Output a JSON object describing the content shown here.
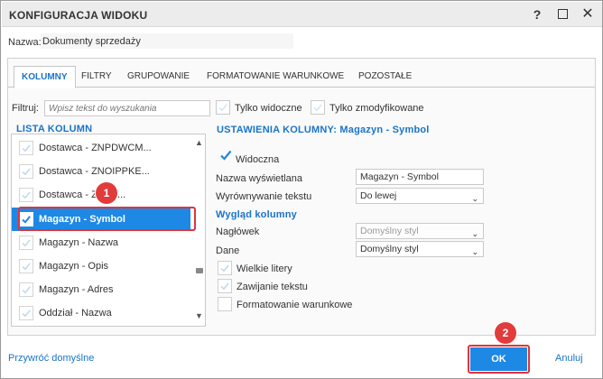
{
  "window": {
    "title": "KONFIGURACJA WIDOKU",
    "help_glyph": "?",
    "close_glyph": "✕"
  },
  "name": {
    "label": "Nazwa:",
    "value": "Dokumenty sprzedaży"
  },
  "tabs": [
    {
      "label": "KOLUMNY",
      "active": true
    },
    {
      "label": "FILTRY",
      "active": false
    },
    {
      "label": "GRUPOWANIE",
      "active": false
    },
    {
      "label": "FORMATOWANIE WARUNKOWE",
      "active": false
    },
    {
      "label": "POZOSTAŁE",
      "active": false
    }
  ],
  "filter": {
    "label": "Filtruj:",
    "placeholder": "Wpisz tekst do wyszukania",
    "only_visible": "Tylko widoczne",
    "only_modified": "Tylko zmodyfikowane"
  },
  "column_list": {
    "title": "LISTA KOLUMN",
    "items": [
      {
        "label": "Dostawca - ZNPDWCM...",
        "checked": true,
        "selected": false
      },
      {
        "label": "Dostawca - ZNOIPPKE...",
        "checked": true,
        "selected": false
      },
      {
        "label": "Dostawca - ZNNV...",
        "checked": true,
        "selected": false
      },
      {
        "label": "Magazyn - Symbol",
        "checked": true,
        "selected": true
      },
      {
        "label": "Magazyn - Nazwa",
        "checked": true,
        "selected": false
      },
      {
        "label": "Magazyn - Opis",
        "checked": true,
        "selected": false
      },
      {
        "label": "Magazyn - Adres",
        "checked": true,
        "selected": false
      },
      {
        "label": "Oddział - Nazwa",
        "checked": true,
        "selected": false
      }
    ]
  },
  "settings": {
    "title": "USTAWIENIA KOLUMNY: Magazyn - Symbol",
    "visible_label": "Widoczna",
    "display_name_label": "Nazwa wyświetlana",
    "display_name_value": "Magazyn - Symbol",
    "text_align_label": "Wyrównywanie tekstu",
    "text_align_value": "Do lewej",
    "appearance_title": "Wygląd kolumny",
    "header_label": "Nagłówek",
    "header_value": "Domyślny styl",
    "data_label": "Dane",
    "data_value": "Domyślny styl",
    "options": [
      {
        "label": "Wielkie litery",
        "checked": true
      },
      {
        "label": "Zawijanie tekstu",
        "checked": true
      },
      {
        "label": "Formatowanie warunkowe",
        "checked": false
      }
    ]
  },
  "annotations": {
    "badge1": "1",
    "badge2": "2"
  },
  "footer": {
    "restore": "Przywróć domyślne",
    "ok": "OK",
    "cancel": "Anuluj"
  },
  "colors": {
    "accent": "#1e88e5",
    "link": "#1a74c9",
    "annotation": "#e23b3b"
  }
}
